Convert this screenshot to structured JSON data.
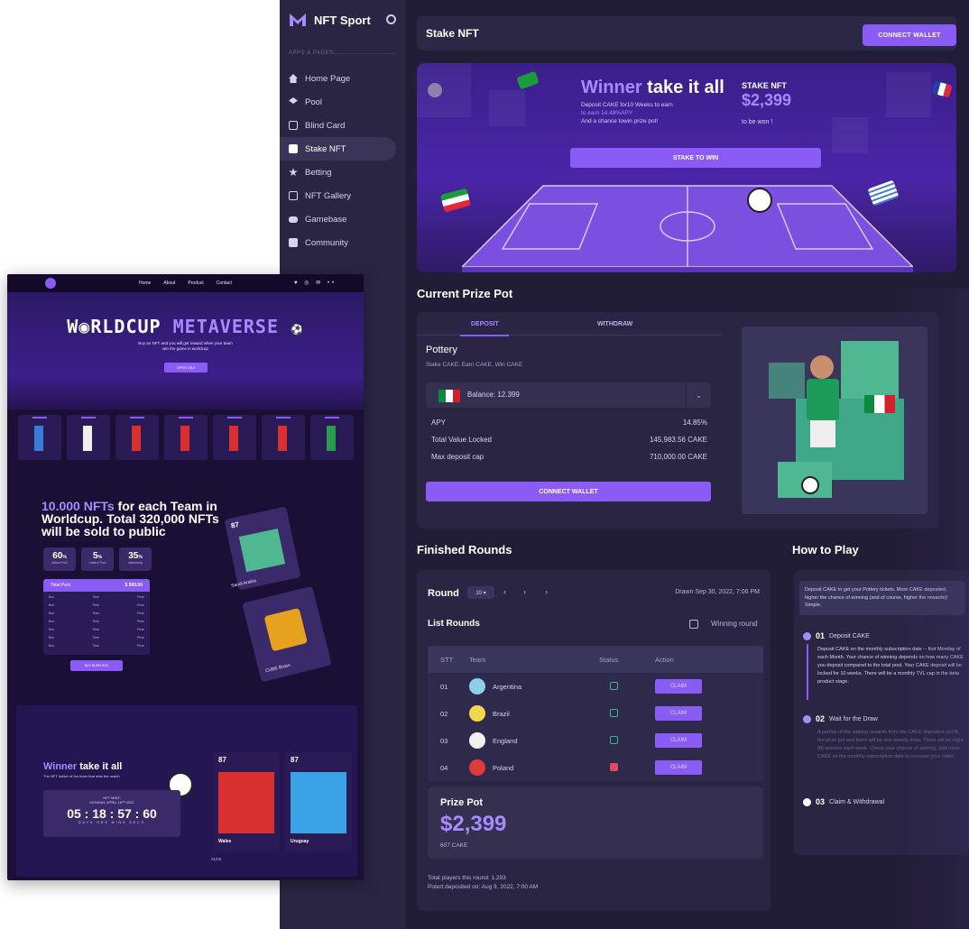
{
  "app": {
    "brand": "NFT Sport",
    "section_label": "APPS & PAGES",
    "nav": [
      {
        "label": "Home Page",
        "icon": "home-icon"
      },
      {
        "label": "Pool",
        "icon": "pool-icon"
      },
      {
        "label": "Blind Card",
        "icon": "card-icon"
      },
      {
        "label": "Stake NFT",
        "icon": "ticket-icon",
        "active": true
      },
      {
        "label": "Betting",
        "icon": "star-icon"
      },
      {
        "label": "NFT Gallery",
        "icon": "gallery-icon"
      },
      {
        "label": "Gamebase",
        "icon": "gamepad-icon"
      },
      {
        "label": "Community",
        "icon": "chat-icon"
      }
    ],
    "header": {
      "title": "Stake NFT",
      "connect_wallet": "CONNECT WALLET"
    },
    "hero": {
      "title_a": "Winner",
      "title_b": " take it all",
      "desc_1": "Deposit CAKE for10 Weeks to earn",
      "desc_2": "to earn 14.48%APY",
      "desc_3": "And a chance towin prize pot!",
      "stake_label": "STAKE NFT",
      "stake_amount": "$2,399",
      "stake_won": "to be won !",
      "button": "STAKE TO WIN"
    },
    "prize_pot": {
      "heading": "Current Prize Pot",
      "tab_deposit": "DEPOSIT",
      "tab_withdraw": "WITHDRAW",
      "pottery_title": "Pottery",
      "pottery_sub": "Stake CAKE, Earn CAKE, Win CAKE",
      "balance": "Balance: 12.399",
      "stats": [
        {
          "label": "APY",
          "value": "14.85%"
        },
        {
          "label": "Total Value Locked",
          "value": "145,983.56 CAKE"
        },
        {
          "label": "Max deposit cap",
          "value": "710,000.00 CAKE"
        }
      ],
      "button": "CONNECT WALLET"
    },
    "finished": {
      "heading": "Finished Rounds",
      "round_label": "Round",
      "round_select": "10 ▾",
      "drawn": "Drawn Sep 30, 2022, 7:06 PM",
      "list_title": "List Rounds",
      "winning_round": "Winning round",
      "columns": [
        "STT",
        "Team",
        "Status",
        "Action"
      ],
      "rows": [
        {
          "stt": "01",
          "team": "Argentina",
          "status": "unlocked",
          "action": "CLAIM"
        },
        {
          "stt": "02",
          "team": "Brazil",
          "status": "unlocked",
          "action": "CLAIM"
        },
        {
          "stt": "03",
          "team": "England",
          "status": "unlocked",
          "action": "CLAIM"
        },
        {
          "stt": "04",
          "team": "Poland",
          "status": "locked",
          "action": "CLAIM"
        }
      ],
      "prize_title": "Prize Pot",
      "prize_amount": "$2,399",
      "prize_sub": "607 CAKE",
      "footer_1": "Total players this round: 1.293",
      "footer_2": "Potert deposited on: Aug 9, 2022, 7:00 AM"
    },
    "how_to_play": {
      "heading": "How to Play",
      "intro": "Deposit CAKE to get your Pottery tickets. More CAKE deposited, higher the chance of winning (and of course, higher the rewards)! Simple.",
      "steps": [
        {
          "num": "01",
          "title": "Deposit CAKE",
          "body": "Deposit CAKE on the monthly subscription date -- first Monday of each Month. Your chance of winning depends on how many CAKE you deposit compared to the total pool. Your CAKE deposit will be locked for 10 weeks. There will be a monthly TVL cap in the beta product stage."
        },
        {
          "num": "02",
          "title": "Wait for the Draw",
          "body": "A portion of the staking rewards from the CAKE deposited will fill the prize pot and there will be one weekly draw. There will be eight (8) winners each week. Check your chance of winning, add more CAKE on the monthly subscription date to increase your odds!"
        },
        {
          "num": "03",
          "title": "Claim & Withdrawal",
          "body": ""
        }
      ]
    }
  },
  "site": {
    "nav_links": [
      "Home",
      "About",
      "Product",
      "Contact"
    ],
    "social": "♥ ◎ ✉ ••",
    "title_a": "W",
    "title_b": "RLDCUP ",
    "title_c": "METAVERSE",
    "subtitle_1": "Buy an NFT and you will get reward when your team",
    "subtitle_2": "win the game in worldcup",
    "open_sea": "OPEN SEA",
    "big_a": "10.000 NFTs",
    "big_b": " for each Team in Worldcup. Total 320,000 NFTs will be sold to public",
    "stats": [
      {
        "value": "60",
        "unit": "%",
        "label": "Match Pool"
      },
      {
        "value": "5",
        "unit": "%",
        "label": "Lottery Pool"
      },
      {
        "value": "35",
        "unit": "%",
        "label": "Marketing"
      }
    ],
    "pool_label": "Total Pool",
    "pool_value": "$ 500.00",
    "pool_cols": [
      "Box",
      "Time",
      "Price"
    ],
    "buy_button": "BUY BLIND BOX",
    "nft_num": "87",
    "nft_label_1": "Saudi Arabia",
    "nft_label_2": "CUBE Brass",
    "win_a": "Winner",
    "win_b": " take it all",
    "win_sub": "The NFT holder of the team that wins the match",
    "mint_1": "NFT MINT:",
    "mint_2": "MONDAY, APRIL 18ᵀᴴ 2022",
    "countdown": "05 : 18 : 57 : 60",
    "cd_labels": "DAYS  HRS  MINS  SECS",
    "teams": [
      {
        "num": "87",
        "name": "Wales"
      },
      {
        "num": "87",
        "name": "Uruguay"
      }
    ],
    "pager": "01/03"
  }
}
